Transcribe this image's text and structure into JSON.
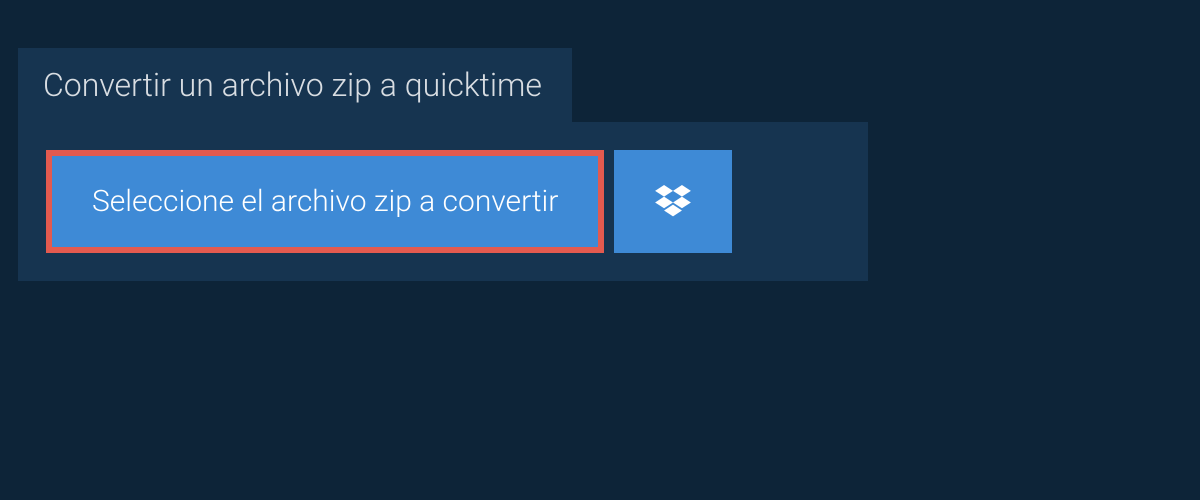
{
  "tab": {
    "title": "Convertir un archivo zip a quicktime"
  },
  "actions": {
    "select_file_label": "Seleccione el archivo zip a convertir"
  }
}
